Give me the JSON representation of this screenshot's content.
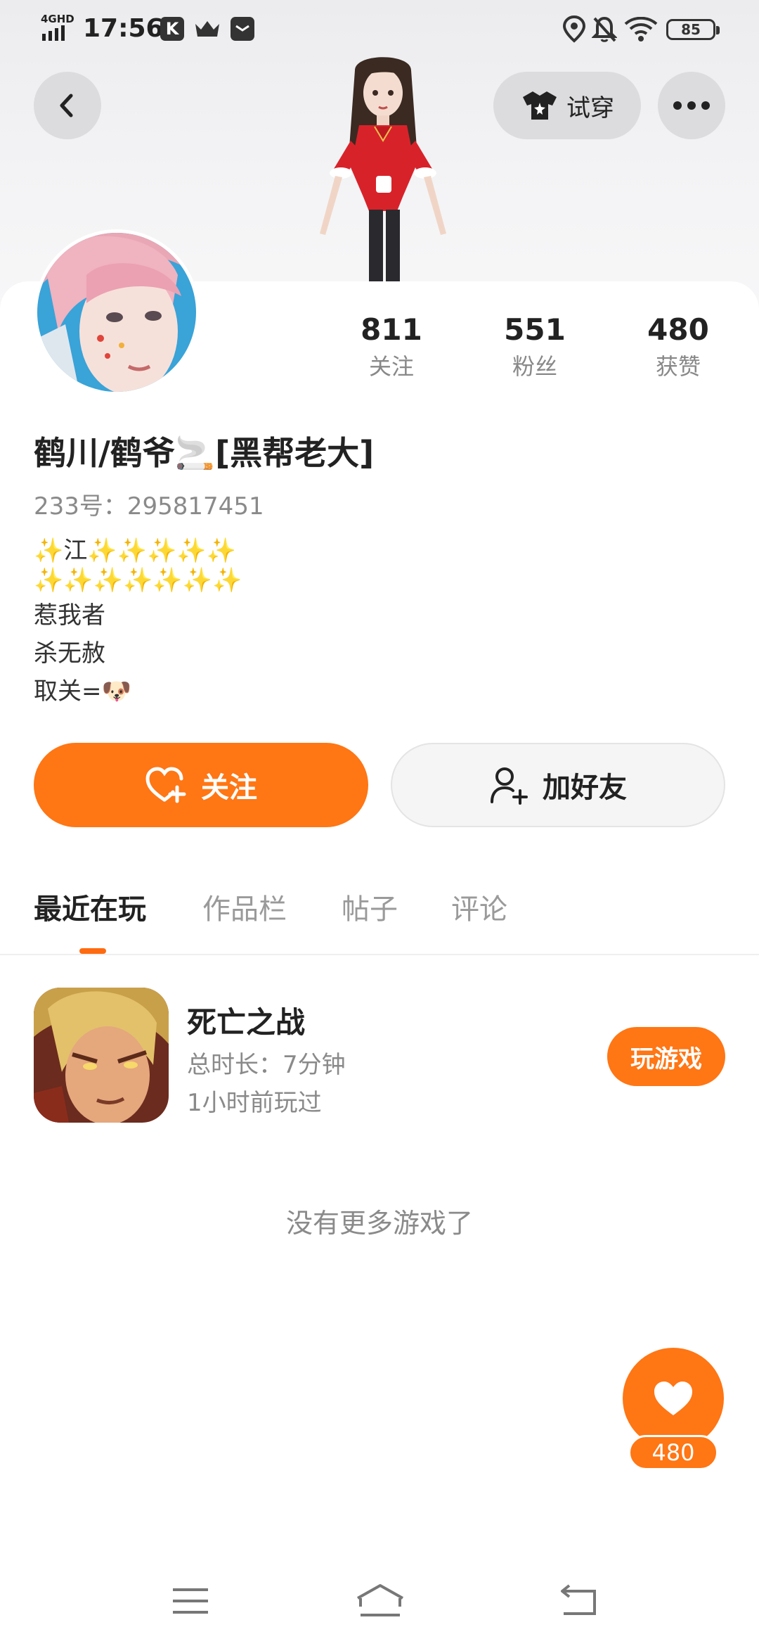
{
  "status_bar": {
    "network": "4GHD",
    "time": "17:56",
    "app_icons": [
      "k-app-icon",
      "crown-icon",
      "mail-icon"
    ],
    "battery": "85"
  },
  "header": {
    "try_on_label": "试穿"
  },
  "stats": [
    {
      "value": "811",
      "label": "关注"
    },
    {
      "value": "551",
      "label": "粉丝"
    },
    {
      "value": "480",
      "label": "获赞"
    }
  ],
  "profile": {
    "name": "鹤川/鹤爷🚬[黑帮老大]",
    "id_line": "233号：295817451",
    "bio": [
      "✨江✨✨✨✨✨",
      "✨✨✨✨✨✨✨",
      "惹我者",
      "杀无赦",
      "取关=🐶"
    ]
  },
  "actions": {
    "follow_label": "关注",
    "add_friend_label": "加好友"
  },
  "tabs": [
    {
      "label": "最近在玩",
      "active": true
    },
    {
      "label": "作品栏",
      "active": false
    },
    {
      "label": "帖子",
      "active": false
    },
    {
      "label": "评论",
      "active": false
    }
  ],
  "games": [
    {
      "title": "死亡之战",
      "duration": "总时长：7分钟",
      "last_played": "1小时前玩过",
      "play_label": "玩游戏"
    }
  ],
  "no_more_text": "没有更多游戏了",
  "likes": {
    "count": "480"
  },
  "colors": {
    "accent": "#ff7614",
    "text": "#222222",
    "muted": "#8a8a8a"
  }
}
